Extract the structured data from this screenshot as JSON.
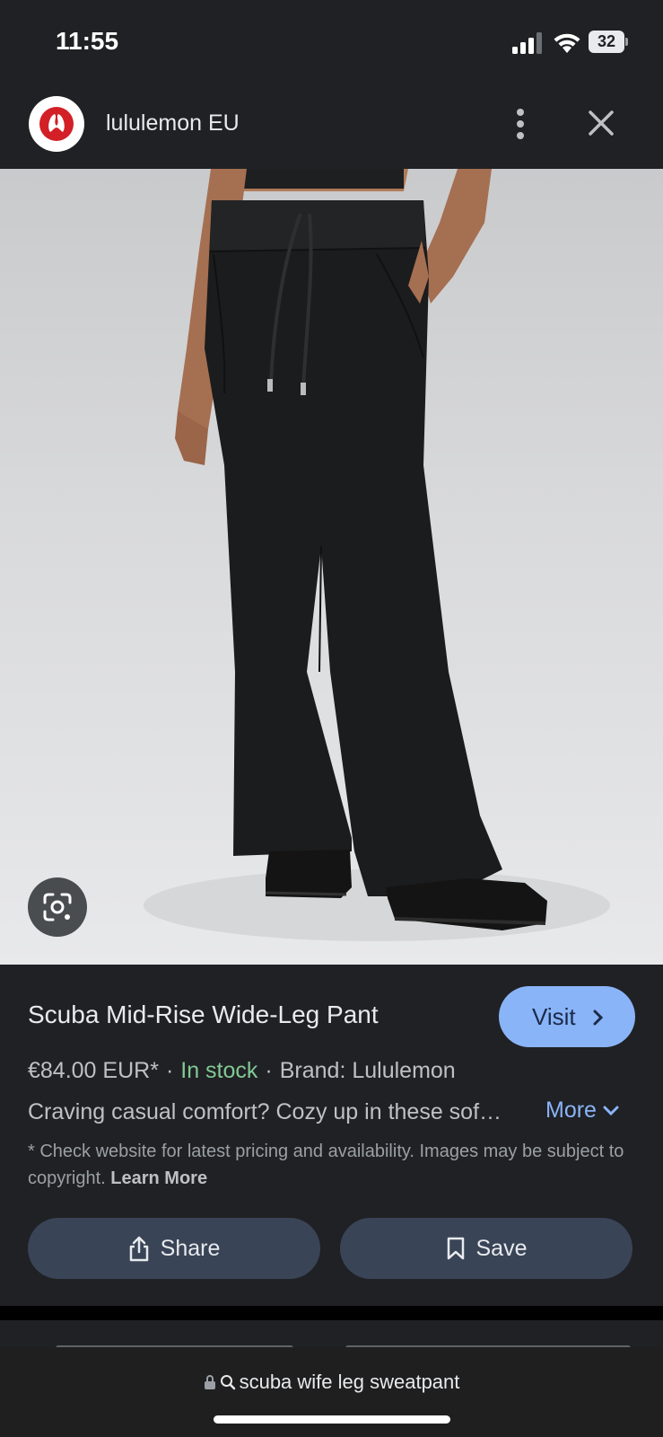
{
  "status": {
    "time": "11:55",
    "battery": "32"
  },
  "header": {
    "site_name": "lululemon EU",
    "logo_icon": "lululemon-logo",
    "menu_icon": "more-vert-icon",
    "close_icon": "close-icon"
  },
  "image": {
    "alt_subject": "black wide-leg sweatpants",
    "lens_icon": "lens-icon"
  },
  "product": {
    "title": "Scuba Mid-Rise Wide-Leg Pant",
    "visit_label": "Visit",
    "price": "€84.00 EUR*",
    "separator": "·",
    "stock": "In stock",
    "brand": "Brand: Lululemon",
    "description": "Craving casual comfort? Cozy up in these sof…",
    "more_label": "More",
    "disclaimer": "* Check website for latest pricing and availability. Images may be subject to copyright.",
    "learn_more": "Learn More"
  },
  "actions": {
    "share_label": "Share",
    "save_label": "Save"
  },
  "bottom": {
    "url": "scuba wife leg sweatpant"
  },
  "colors": {
    "accent": "#8ab4f8",
    "stock": "#81c995",
    "background": "#202124",
    "pill": "#394457"
  }
}
